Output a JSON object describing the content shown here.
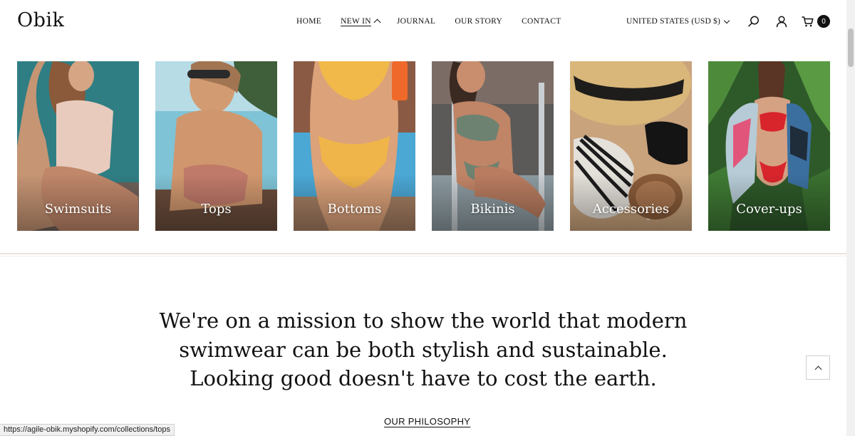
{
  "header": {
    "logo": "Obik",
    "nav": [
      {
        "label": "HOME"
      },
      {
        "label": "NEW IN"
      },
      {
        "label": "JOURNAL"
      },
      {
        "label": "OUR STORY"
      },
      {
        "label": "CONTACT"
      }
    ],
    "currency": "UNITED STATES (USD $)",
    "cart_count": "0"
  },
  "categories": [
    {
      "label": "Swimsuits"
    },
    {
      "label": "Tops"
    },
    {
      "label": "Bottoms"
    },
    {
      "label": "Bikinis"
    },
    {
      "label": "Accessories"
    },
    {
      "label": "Cover-ups"
    }
  ],
  "mission": {
    "lines": [
      "We're on a mission to show the world that modern",
      "swimwear can be both stylish and sustainable.",
      "Looking good doesn't have to cost the earth."
    ],
    "link": "OUR PHILOSOPHY"
  },
  "status_bar": {
    "url": "https://agile-obik.myshopify.com/collections/tops"
  }
}
